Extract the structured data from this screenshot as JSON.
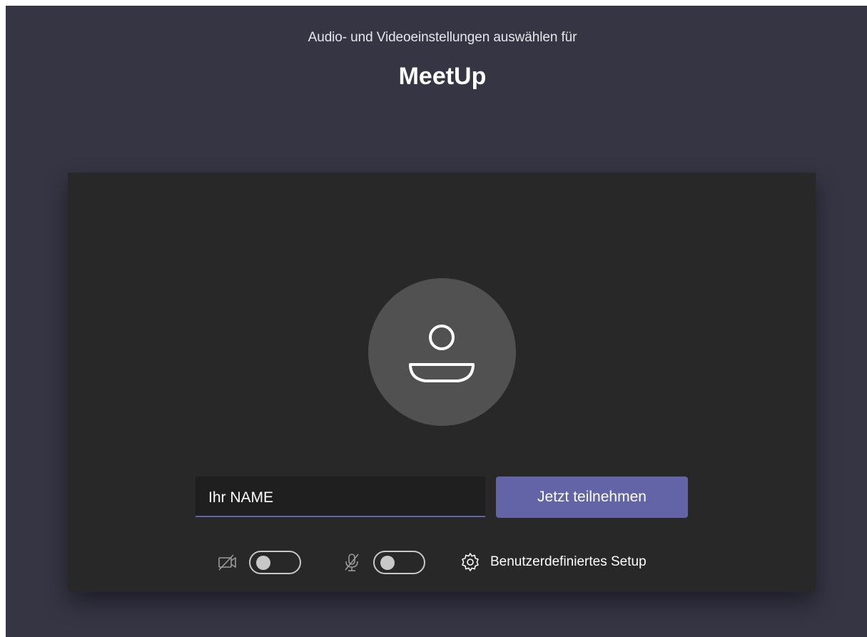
{
  "header": {
    "subtitle": "Audio- und Videoeinstellungen auswählen für",
    "meeting_title": "MeetUp"
  },
  "join": {
    "name_value": "Ihr NAME",
    "join_button_label": "Jetzt teilnehmen"
  },
  "controls": {
    "camera": {
      "icon": "camera-off-icon",
      "enabled": false
    },
    "microphone": {
      "icon": "mic-off-icon",
      "enabled": false
    },
    "custom_setup": {
      "icon": "gear-icon",
      "label": "Benutzerdefiniertes Setup"
    }
  },
  "colors": {
    "background": "#363544",
    "panel": "#282828",
    "accent": "#6264a7",
    "avatar": "#515151"
  }
}
